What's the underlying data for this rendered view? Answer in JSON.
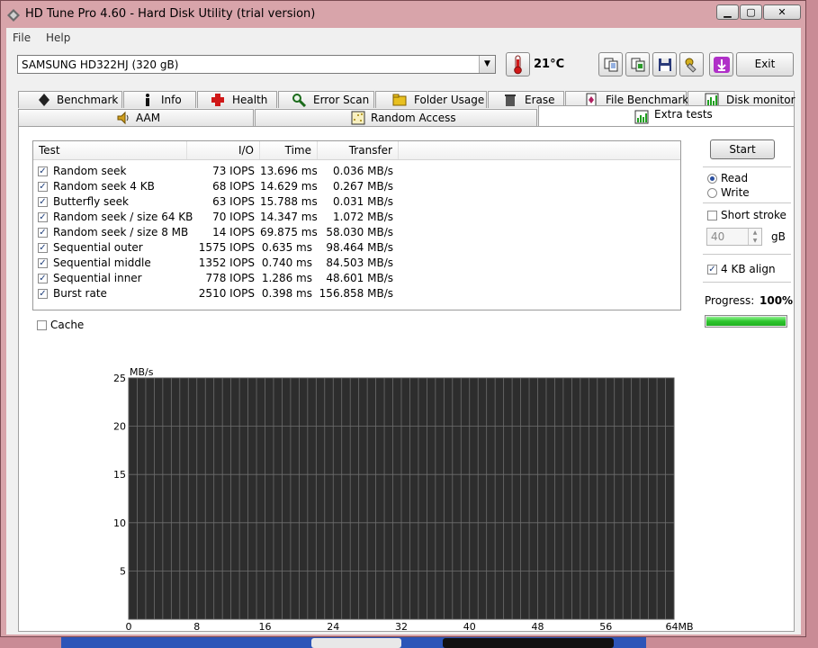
{
  "window": {
    "title": "HD Tune Pro 4.60 - Hard Disk Utility (trial version)"
  },
  "menu": {
    "file": "File",
    "help": "Help"
  },
  "drive": {
    "selected": "SAMSUNG HD322HJ (320 gB)"
  },
  "temperature": "21°C",
  "toolbar": {
    "exit_label": "Exit"
  },
  "tabs_row1": [
    {
      "label": "Benchmark",
      "icon": "benchmark-icon"
    },
    {
      "label": "Info",
      "icon": "info-icon"
    },
    {
      "label": "Health",
      "icon": "health-cross-icon"
    },
    {
      "label": "Error Scan",
      "icon": "magnifier-icon"
    },
    {
      "label": "Folder Usage",
      "icon": "folder-icon"
    },
    {
      "label": "Erase",
      "icon": "trash-icon"
    },
    {
      "label": "File Benchmark",
      "icon": "file-benchmark-icon"
    },
    {
      "label": "Disk monitor",
      "icon": "disk-monitor-icon"
    }
  ],
  "tabs_row2": [
    {
      "label": "AAM",
      "icon": "speaker-icon"
    },
    {
      "label": "Random Access",
      "icon": "random-access-icon"
    },
    {
      "label": "Extra tests",
      "icon": "extra-tests-icon",
      "active": true
    }
  ],
  "table": {
    "columns": [
      "Test",
      "I/O",
      "Time",
      "Transfer"
    ],
    "rows": [
      {
        "test": "Random seek",
        "io": "73 IOPS",
        "time": "13.696 ms",
        "transfer": "0.036 MB/s",
        "checked": true
      },
      {
        "test": "Random seek 4 KB",
        "io": "68 IOPS",
        "time": "14.629 ms",
        "transfer": "0.267 MB/s",
        "checked": true
      },
      {
        "test": "Butterfly seek",
        "io": "63 IOPS",
        "time": "15.788 ms",
        "transfer": "0.031 MB/s",
        "checked": true
      },
      {
        "test": "Random seek / size 64 KB",
        "io": "70 IOPS",
        "time": "14.347 ms",
        "transfer": "1.072 MB/s",
        "checked": true
      },
      {
        "test": "Random seek / size 8 MB",
        "io": "14 IOPS",
        "time": "69.875 ms",
        "transfer": "58.030 MB/s",
        "checked": true
      },
      {
        "test": "Sequential outer",
        "io": "1575 IOPS",
        "time": "0.635 ms",
        "transfer": "98.464 MB/s",
        "checked": true
      },
      {
        "test": "Sequential middle",
        "io": "1352 IOPS",
        "time": "0.740 ms",
        "transfer": "84.503 MB/s",
        "checked": true
      },
      {
        "test": "Sequential inner",
        "io": "778 IOPS",
        "time": "1.286 ms",
        "transfer": "48.601 MB/s",
        "checked": true
      },
      {
        "test": "Burst rate",
        "io": "2510 IOPS",
        "time": "0.398 ms",
        "transfer": "156.858 MB/s",
        "checked": true
      }
    ]
  },
  "controls": {
    "start_label": "Start",
    "read_label": "Read",
    "write_label": "Write",
    "mode_selected": "Read",
    "short_stroke_label": "Short stroke",
    "short_stroke_checked": false,
    "stroke_value": "40",
    "stroke_unit": "gB",
    "align_label": "4 KB align",
    "align_checked": true,
    "progress_label": "Progress:",
    "progress_value": "100%",
    "progress_fraction": 1.0,
    "cache_label": "Cache",
    "cache_checked": false
  },
  "chart_data": {
    "type": "line",
    "ylabel": "MB/s",
    "xlabel": "",
    "ylim": [
      0,
      25
    ],
    "xlim": [
      0,
      64
    ],
    "yticks": [
      "25",
      "20",
      "15",
      "10",
      "5"
    ],
    "xticks": [
      "0",
      "8",
      "16",
      "24",
      "32",
      "40",
      "48",
      "56",
      "64MB"
    ],
    "grid": true,
    "series": []
  },
  "colors": {
    "chart_bg": "#2d2d2d",
    "chart_grid": "#6e6e6e",
    "progress": "#2ec62e"
  }
}
